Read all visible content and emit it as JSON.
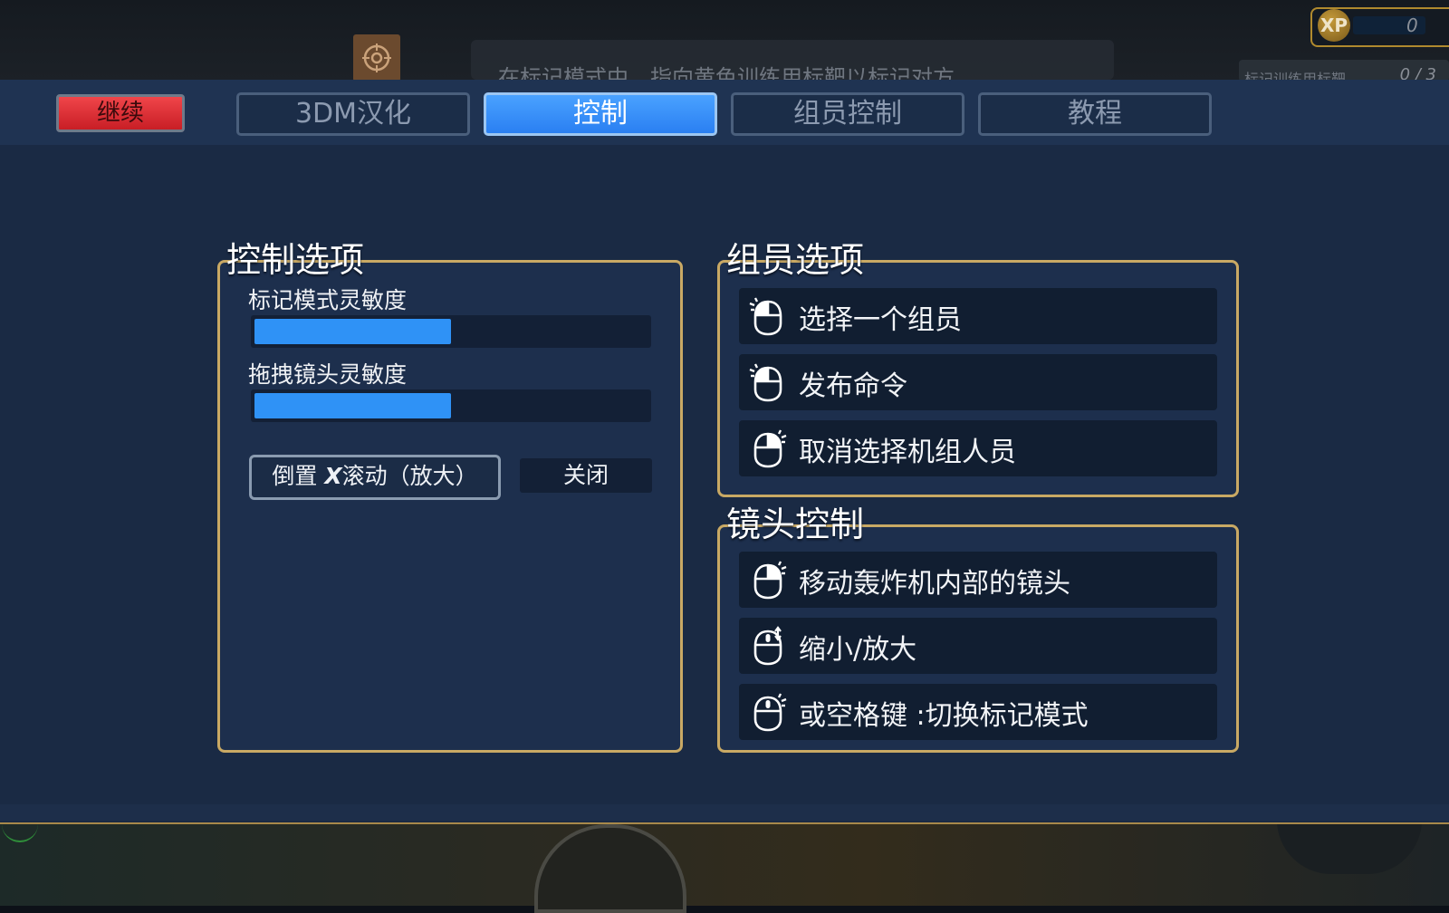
{
  "background": {
    "hint_text": "在标记模式中，指向黄色训练用标靶以标记对方",
    "counter_label": "标记训练用标靶",
    "counter_value": "0 / 3",
    "xp_label": "XP",
    "xp_value": "0"
  },
  "toolbar": {
    "continue_label": "继续",
    "tabs": [
      {
        "label": "3DM汉化",
        "active": false
      },
      {
        "label": "控制",
        "active": true
      },
      {
        "label": "组员控制",
        "active": false
      },
      {
        "label": "教程",
        "active": false
      }
    ]
  },
  "control_options": {
    "title": "控制选项",
    "sliders": [
      {
        "label": "标记模式灵敏度",
        "value": 0.5
      },
      {
        "label": "拖拽镜头灵敏度",
        "value": 0.5
      }
    ],
    "invert_button": {
      "prefix": "倒置 ",
      "key": "X",
      "suffix": "滚动（放大）"
    },
    "invert_state": "关闭"
  },
  "crew_options": {
    "title": "组员选项",
    "items": [
      {
        "icon": "mouse-left-click-icon",
        "label": "选择一个组员"
      },
      {
        "icon": "mouse-left-click-icon",
        "label": "发布命令"
      },
      {
        "icon": "mouse-right-click-icon",
        "label": "取消选择机组人员"
      }
    ]
  },
  "camera_control": {
    "title": "镜头控制",
    "items": [
      {
        "icon": "mouse-right-click-icon",
        "label": "移动轰炸机内部的镜头"
      },
      {
        "icon": "mouse-scroll-icon",
        "label": "缩小/放大"
      },
      {
        "icon": "mouse-middle-click-icon",
        "label": "或空格键 :切换标记模式"
      }
    ]
  },
  "colors": {
    "panel_bg": "#1a2a44",
    "frame_border": "#c9a964",
    "slider_fill": "#2f92f6",
    "tab_active": "#2a7ff2",
    "continue_button": "#e03238"
  }
}
